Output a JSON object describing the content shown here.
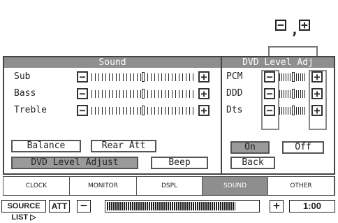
{
  "callout": {
    "minus": "−",
    "comma": ",",
    "plus": "+"
  },
  "sound_panel": {
    "title": "Sound",
    "rows": [
      {
        "label": "Sub",
        "minus": "−",
        "plus": "+",
        "level": 0.5
      },
      {
        "label": "Bass",
        "minus": "−",
        "plus": "+",
        "level": 0.5
      },
      {
        "label": "Treble",
        "minus": "−",
        "plus": "+",
        "level": 0.5
      }
    ],
    "buttons": {
      "balance": "Balance",
      "rear_att": "Rear Att",
      "dvd_level_adjust": "DVD Level Adjust",
      "beep": "Beep"
    }
  },
  "dvd_panel": {
    "title": "DVD Level Adj",
    "rows": [
      {
        "label": "PCM",
        "minus": "−",
        "plus": "+",
        "level": 0.5
      },
      {
        "label": "DDD",
        "minus": "−",
        "plus": "+",
        "level": 0.5
      },
      {
        "label": "Dts",
        "minus": "−",
        "plus": "+",
        "level": 0.5
      }
    ],
    "buttons": {
      "on": "On",
      "off": "Off",
      "back": "Back"
    }
  },
  "tabs": [
    {
      "label": "CLOCK",
      "active": false
    },
    {
      "label": "MONITOR",
      "active": false
    },
    {
      "label": "DSPL",
      "active": false
    },
    {
      "label": "SOUND",
      "active": true
    },
    {
      "label": "OTHER",
      "active": false
    }
  ],
  "bottom_bar": {
    "source_list": "SOURCE LIST ▷",
    "att": "ATT",
    "volume_minus": "−",
    "volume_plus": "+",
    "volume_level": 0.85,
    "time": "1:00"
  },
  "colors": {
    "header_bg": "#8e8e8e",
    "active_button": "#9a9a9a",
    "border": "#444444"
  }
}
